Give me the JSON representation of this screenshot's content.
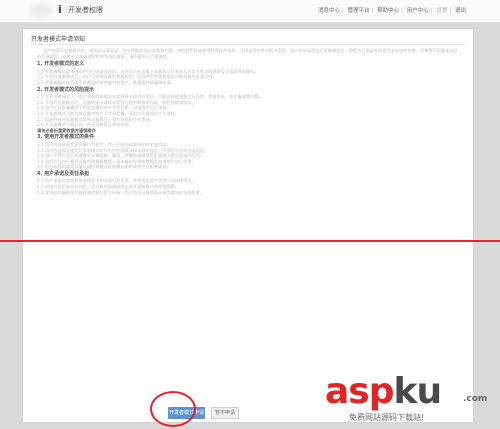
{
  "header": {
    "logo_letter": "i",
    "title": "开发者权限",
    "nav": [
      "消息中心",
      "管理平台",
      "帮助中心",
      "用户中心",
      "设置",
      "退出"
    ],
    "nav_dim": "设置"
  },
  "agreement": {
    "title": "开发者模式申请须知",
    "intro": "用户申请开发者模式前，请务必认真阅读、充分理解本协议各条款内容，特别是免除或者限制责任的条款、法律适用和争议解决条款。用户在申请开启开发者模式后，即视为已阅读并同意受本协议的约束。如果您不同意本协议的任意内容，或者无法准确理解相关条款的解释，请不要进行后续操作。",
    "sections": [
      {
        "heading": "1. 开发者模式的定义",
        "items": [
          "1.1 开发者模式是指由用户自行申请开启的、允许用户在设备上安装和运行未经官方签名验证的系统及应用程序的模式。",
          "1.2 开启开发者模式后，用户可获得设备的更高权限，但同时也将承担由此可能带来的全部风险。",
          "1.3 开发者模式仅适用于具备相应技术能力的用户，普通用户请谨慎申请。"
        ]
      },
      {
        "heading": "2. 开发者模式的风险提示",
        "items": [
          "2.1 在开发者模式下，用户安装的系统及应用程序未经官方验证，可能会导致设备运行异常、数据丢失、安全漏洞等问题。",
          "2.2 开启开发者模式后，设备将无法继续享受官方提供的系统升级、售后保修等服务。",
          "2.3 用户在开发者模式下的全部操作所产生的后果，均由用户自行承担。",
          "2.4 开发者模式可能导致设备中的个人信息泄露，请用户注意保护个人隐私。",
          "2.5 如因开启开发者模式导致设备损坏，官方不承担任何责任。",
          "2.6 开发者模式一经开启，将无法恢复至原始状态。"
        ]
      },
      {
        "heading": "3. 使用开发者模式的条件",
        "items": [
          "3.1 用户应当具备完全民事行为能力，并已仔细阅读本协议的全部内容。",
          "3.2 用户应当保证使用开发者模式的行为符合国家法律法规的规定，不得用于任何违法用途。",
          "3.3 用户不得利用开发者模式从事破解、篡改、传播恶意程序等危害他人合法权益的行为。",
          "3.4 用户应当自行备份设备中的重要数据，因未备份导致的数据丢失由用户自行负责。",
          "3.5 官方有权根据实际情况随时调整开发者模式的申请条件及相关规则。"
        ]
      },
      {
        "heading": "4. 用户承诺及责任承担",
        "items": [
          "4.1 用户承诺对其在开发者模式下的全部行为负责，并承担由此产生的一切法律责任。",
          "4.2 如用户违反本协议约定，官方有权暂停或终止其开发者模式的使用资格。",
          "4.3 本协议的解释权及最终修改权归官方所有，用户点击同意即表示接受本协议全部条款。"
        ]
      }
    ],
    "highlight": "请务必备份重要数据并谨慎操作"
  },
  "buttons": {
    "agree": "开发者模式申请",
    "cancel": "暂不申请"
  },
  "watermark": {
    "brand_main": "asp",
    "brand_ku": "ku",
    "brand_tld": ".com",
    "subtitle": "免费网站源码下载站!"
  },
  "colors": {
    "accent": "#5b93cf",
    "annotation_red": "#e8232d"
  }
}
